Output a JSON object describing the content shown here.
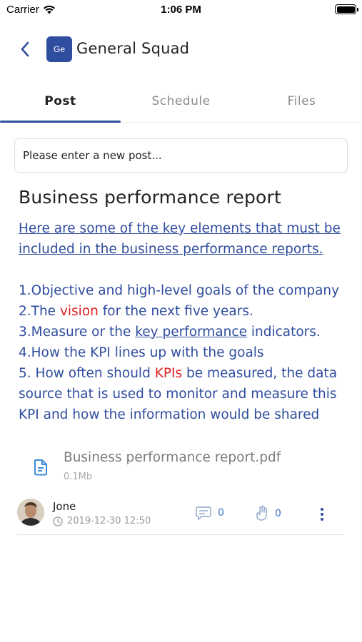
{
  "status_bar": {
    "carrier": "Carrier",
    "time": "1:06 PM",
    "battery_level": 1.0
  },
  "header": {
    "group_initials": "Ge",
    "group_name": "General Squad",
    "avatar_color": "#2f4d9e"
  },
  "tabs": [
    {
      "label": "Post",
      "active": true
    },
    {
      "label": "Schedule",
      "active": false
    },
    {
      "label": "Files",
      "active": false
    }
  ],
  "composer": {
    "placeholder": "Please enter a new post..."
  },
  "post": {
    "title": "Business performance report",
    "intro": "Here are some of the key elements that must be included in the business performance reports.",
    "items": {
      "item1": "1.Objective and high-level goals of the company",
      "item2_a": "2.The ",
      "item2_highlight": "vision",
      "item2_b": " for the next five years.",
      "item3_a": "3.Measure or the ",
      "item3_link": "key performance",
      "item3_b": " indicators.",
      "item4": "4.How the KPI lines up with the goals",
      "item5_a": "5. How often should ",
      "item5_highlight": "KPIs",
      "item5_b": " be measured, the data",
      "item5_c": "source that is used to monitor and measure this",
      "item5_d": "KPI and how the information would be shared"
    },
    "attachment": {
      "icon": "file-document-icon",
      "name": "Business performance report.pdf",
      "size": "0.1Mb"
    },
    "author": "Jone",
    "timestamp": "2019-12-30 12:50",
    "comment_count": "0",
    "like_count": "0"
  },
  "colors": {
    "accent": "#2f4d9e",
    "link_blue": "#3d73c6",
    "highlight_red": "#e02020"
  }
}
